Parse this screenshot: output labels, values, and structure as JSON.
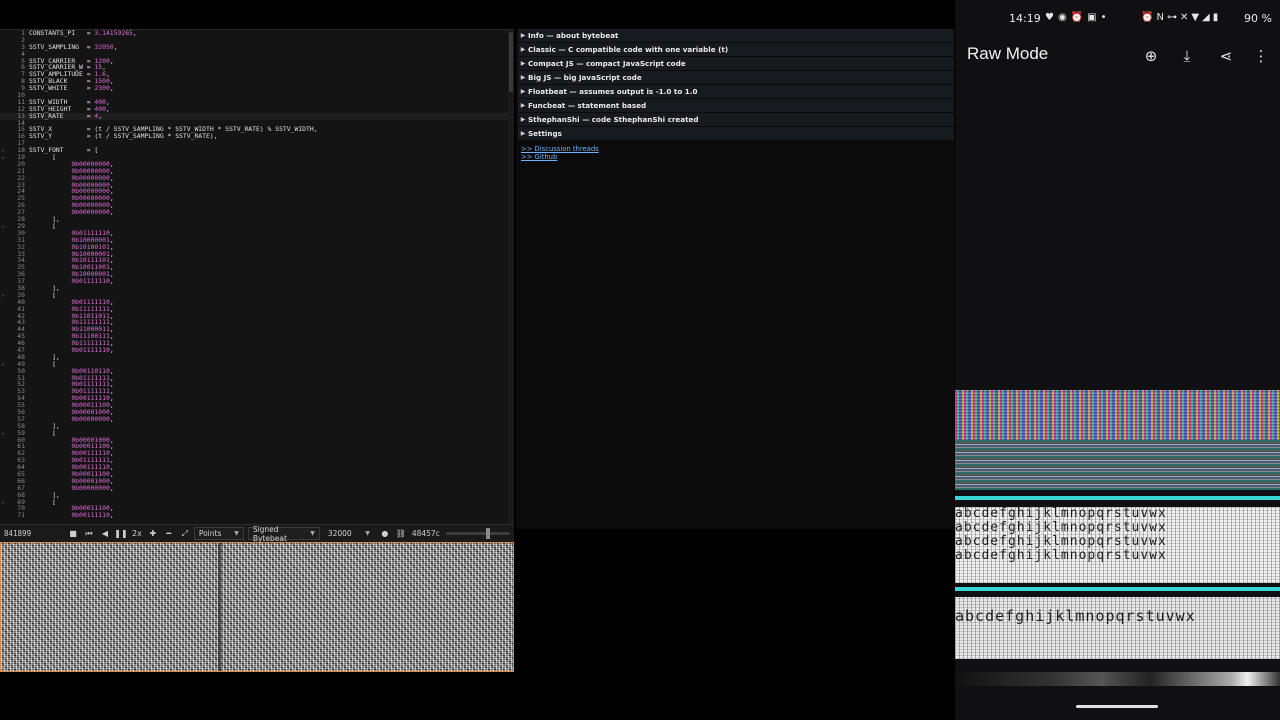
{
  "editor": {
    "lines": [
      {
        "n": "1",
        "code": [
          [
            "i",
            "CONSTANTS_PI   = "
          ],
          [
            "n",
            "3.14159265"
          ],
          [
            "i",
            ","
          ]
        ]
      },
      {
        "n": "2",
        "code": []
      },
      {
        "n": "3",
        "code": [
          [
            "i",
            "SSTV_SAMPLING  = "
          ],
          [
            "n",
            "32050"
          ],
          [
            "i",
            ","
          ]
        ]
      },
      {
        "n": "4",
        "code": []
      },
      {
        "n": "5",
        "code": [
          [
            "i",
            "SSTV_CARRIER   = "
          ],
          [
            "n",
            "1200"
          ],
          [
            "i",
            ","
          ]
        ]
      },
      {
        "n": "6",
        "code": [
          [
            "i",
            "SSTV_CARRIER_W = "
          ],
          [
            "n",
            "15"
          ],
          [
            "i",
            ","
          ]
        ]
      },
      {
        "n": "7",
        "code": [
          [
            "i",
            "SSTV_AMPLITUDE = "
          ],
          [
            "n",
            "1.6"
          ],
          [
            "i",
            ","
          ]
        ]
      },
      {
        "n": "8",
        "code": [
          [
            "i",
            "SSTV_BLACK     = "
          ],
          [
            "n",
            "1500"
          ],
          [
            "i",
            ","
          ]
        ]
      },
      {
        "n": "9",
        "code": [
          [
            "i",
            "SSTV_WHITE     = "
          ],
          [
            "n",
            "2300"
          ],
          [
            "i",
            ","
          ]
        ]
      },
      {
        "n": "10",
        "code": []
      },
      {
        "n": "11",
        "code": [
          [
            "i",
            "SSTV_WIDTH     = "
          ],
          [
            "n",
            "400"
          ],
          [
            "i",
            ","
          ]
        ]
      },
      {
        "n": "12",
        "code": [
          [
            "i",
            "SSTV_HEIGHT    = "
          ],
          [
            "n",
            "400"
          ],
          [
            "i",
            ","
          ]
        ]
      },
      {
        "n": "13",
        "code": [
          [
            "i",
            "SSTV_RATE      = "
          ],
          [
            "n",
            "4"
          ],
          [
            "i",
            ","
          ]
        ],
        "current": true
      },
      {
        "n": "14",
        "code": []
      },
      {
        "n": "15",
        "code": [
          [
            "i",
            "SSTV_X         = (t / SSTV_SAMPLING * SSTV_WIDTH * SSTV_RATE) % SSTV_WIDTH,"
          ]
        ]
      },
      {
        "n": "16",
        "code": [
          [
            "i",
            "SSTV_Y         = (t / SSTV_SAMPLING * SSTV_RATE),"
          ]
        ]
      },
      {
        "n": "17",
        "code": []
      },
      {
        "n": "18",
        "code": [
          [
            "i",
            "SSTV_FONT      = ["
          ]
        ],
        "fold": true
      },
      {
        "n": "19",
        "code": [
          [
            "i",
            "      ["
          ]
        ],
        "fold": true
      },
      {
        "n": "20",
        "code": [
          [
            "i",
            "           "
          ],
          [
            "n",
            "0b00000000"
          ],
          [
            "i",
            ","
          ]
        ]
      },
      {
        "n": "21",
        "code": [
          [
            "i",
            "           "
          ],
          [
            "n",
            "0b00000000"
          ],
          [
            "i",
            ","
          ]
        ]
      },
      {
        "n": "22",
        "code": [
          [
            "i",
            "           "
          ],
          [
            "n",
            "0b00000000"
          ],
          [
            "i",
            ","
          ]
        ]
      },
      {
        "n": "23",
        "code": [
          [
            "i",
            "           "
          ],
          [
            "n",
            "0b00000000"
          ],
          [
            "i",
            ","
          ]
        ]
      },
      {
        "n": "24",
        "code": [
          [
            "i",
            "           "
          ],
          [
            "n",
            "0b00000000"
          ],
          [
            "i",
            ","
          ]
        ]
      },
      {
        "n": "25",
        "code": [
          [
            "i",
            "           "
          ],
          [
            "n",
            "0b00000000"
          ],
          [
            "i",
            ","
          ]
        ]
      },
      {
        "n": "26",
        "code": [
          [
            "i",
            "           "
          ],
          [
            "n",
            "0b00000000"
          ],
          [
            "i",
            ","
          ]
        ]
      },
      {
        "n": "27",
        "code": [
          [
            "i",
            "           "
          ],
          [
            "n",
            "0b00000000"
          ],
          [
            "i",
            ","
          ]
        ]
      },
      {
        "n": "28",
        "code": [
          [
            "i",
            "      ],"
          ]
        ]
      },
      {
        "n": "29",
        "code": [
          [
            "i",
            "      ["
          ]
        ],
        "fold": true
      },
      {
        "n": "30",
        "code": [
          [
            "i",
            "           "
          ],
          [
            "n",
            "0b01111110"
          ],
          [
            "i",
            ","
          ]
        ]
      },
      {
        "n": "31",
        "code": [
          [
            "i",
            "           "
          ],
          [
            "n",
            "0b10000001"
          ],
          [
            "i",
            ","
          ]
        ]
      },
      {
        "n": "32",
        "code": [
          [
            "i",
            "           "
          ],
          [
            "n",
            "0b10100101"
          ],
          [
            "i",
            ","
          ]
        ]
      },
      {
        "n": "33",
        "code": [
          [
            "i",
            "           "
          ],
          [
            "n",
            "0b10000001"
          ],
          [
            "i",
            ","
          ]
        ]
      },
      {
        "n": "34",
        "code": [
          [
            "i",
            "           "
          ],
          [
            "n",
            "0b10111101"
          ],
          [
            "i",
            ","
          ]
        ]
      },
      {
        "n": "35",
        "code": [
          [
            "i",
            "           "
          ],
          [
            "n",
            "0b10011001"
          ],
          [
            "i",
            ","
          ]
        ]
      },
      {
        "n": "36",
        "code": [
          [
            "i",
            "           "
          ],
          [
            "n",
            "0b10000001"
          ],
          [
            "i",
            ","
          ]
        ]
      },
      {
        "n": "37",
        "code": [
          [
            "i",
            "           "
          ],
          [
            "n",
            "0b01111110"
          ],
          [
            "i",
            ","
          ]
        ]
      },
      {
        "n": "38",
        "code": [
          [
            "i",
            "      ],"
          ]
        ]
      },
      {
        "n": "39",
        "code": [
          [
            "i",
            "      ["
          ]
        ],
        "fold": true
      },
      {
        "n": "40",
        "code": [
          [
            "i",
            "           "
          ],
          [
            "n",
            "0b01111110"
          ],
          [
            "i",
            ","
          ]
        ]
      },
      {
        "n": "41",
        "code": [
          [
            "i",
            "           "
          ],
          [
            "n",
            "0b11111111"
          ],
          [
            "i",
            ","
          ]
        ]
      },
      {
        "n": "42",
        "code": [
          [
            "i",
            "           "
          ],
          [
            "n",
            "0b11011011"
          ],
          [
            "i",
            ","
          ]
        ]
      },
      {
        "n": "43",
        "code": [
          [
            "i",
            "           "
          ],
          [
            "n",
            "0b11111111"
          ],
          [
            "i",
            ","
          ]
        ]
      },
      {
        "n": "44",
        "code": [
          [
            "i",
            "           "
          ],
          [
            "n",
            "0b11000011"
          ],
          [
            "i",
            ","
          ]
        ]
      },
      {
        "n": "45",
        "code": [
          [
            "i",
            "           "
          ],
          [
            "n",
            "0b11100111"
          ],
          [
            "i",
            ","
          ]
        ]
      },
      {
        "n": "46",
        "code": [
          [
            "i",
            "           "
          ],
          [
            "n",
            "0b11111111"
          ],
          [
            "i",
            ","
          ]
        ]
      },
      {
        "n": "47",
        "code": [
          [
            "i",
            "           "
          ],
          [
            "n",
            "0b01111110"
          ],
          [
            "i",
            ","
          ]
        ]
      },
      {
        "n": "48",
        "code": [
          [
            "i",
            "      ],"
          ]
        ]
      },
      {
        "n": "49",
        "code": [
          [
            "i",
            "      ["
          ]
        ],
        "fold": true
      },
      {
        "n": "50",
        "code": [
          [
            "i",
            "           "
          ],
          [
            "n",
            "0b00110110"
          ],
          [
            "i",
            ","
          ]
        ]
      },
      {
        "n": "51",
        "code": [
          [
            "i",
            "           "
          ],
          [
            "n",
            "0b01111111"
          ],
          [
            "i",
            ","
          ]
        ]
      },
      {
        "n": "52",
        "code": [
          [
            "i",
            "           "
          ],
          [
            "n",
            "0b01111111"
          ],
          [
            "i",
            ","
          ]
        ]
      },
      {
        "n": "53",
        "code": [
          [
            "i",
            "           "
          ],
          [
            "n",
            "0b01111111"
          ],
          [
            "i",
            ","
          ]
        ]
      },
      {
        "n": "54",
        "code": [
          [
            "i",
            "           "
          ],
          [
            "n",
            "0b00111110"
          ],
          [
            "i",
            ","
          ]
        ]
      },
      {
        "n": "55",
        "code": [
          [
            "i",
            "           "
          ],
          [
            "n",
            "0b00011100"
          ],
          [
            "i",
            ","
          ]
        ]
      },
      {
        "n": "56",
        "code": [
          [
            "i",
            "           "
          ],
          [
            "n",
            "0b00001000"
          ],
          [
            "i",
            ","
          ]
        ]
      },
      {
        "n": "57",
        "code": [
          [
            "i",
            "           "
          ],
          [
            "n",
            "0b00000000"
          ],
          [
            "i",
            ","
          ]
        ]
      },
      {
        "n": "58",
        "code": [
          [
            "i",
            "      ],"
          ]
        ]
      },
      {
        "n": "59",
        "code": [
          [
            "i",
            "      ["
          ]
        ],
        "fold": true
      },
      {
        "n": "60",
        "code": [
          [
            "i",
            "           "
          ],
          [
            "n",
            "0b00001000"
          ],
          [
            "i",
            ","
          ]
        ]
      },
      {
        "n": "61",
        "code": [
          [
            "i",
            "           "
          ],
          [
            "n",
            "0b00011100"
          ],
          [
            "i",
            ","
          ]
        ]
      },
      {
        "n": "62",
        "code": [
          [
            "i",
            "           "
          ],
          [
            "n",
            "0b00111110"
          ],
          [
            "i",
            ","
          ]
        ]
      },
      {
        "n": "63",
        "code": [
          [
            "i",
            "           "
          ],
          [
            "n",
            "0b01111111"
          ],
          [
            "i",
            ","
          ]
        ]
      },
      {
        "n": "64",
        "code": [
          [
            "i",
            "           "
          ],
          [
            "n",
            "0b00111110"
          ],
          [
            "i",
            ","
          ]
        ]
      },
      {
        "n": "65",
        "code": [
          [
            "i",
            "           "
          ],
          [
            "n",
            "0b00011100"
          ],
          [
            "i",
            ","
          ]
        ]
      },
      {
        "n": "66",
        "code": [
          [
            "i",
            "           "
          ],
          [
            "n",
            "0b00001000"
          ],
          [
            "i",
            ","
          ]
        ]
      },
      {
        "n": "67",
        "code": [
          [
            "i",
            "           "
          ],
          [
            "n",
            "0b00000000"
          ],
          [
            "i",
            ","
          ]
        ]
      },
      {
        "n": "68",
        "code": [
          [
            "i",
            "      ],"
          ]
        ]
      },
      {
        "n": "69",
        "code": [
          [
            "i",
            "      ["
          ]
        ],
        "fold": true
      },
      {
        "n": "70",
        "code": [
          [
            "i",
            "           "
          ],
          [
            "n",
            "0b00011100"
          ],
          [
            "i",
            ","
          ]
        ]
      },
      {
        "n": "71",
        "code": [
          [
            "i",
            "           "
          ],
          [
            "n",
            "0b00111110"
          ],
          [
            "i",
            ","
          ]
        ]
      }
    ]
  },
  "controls": {
    "time": "841899",
    "rate_label": "2x",
    "mode": "Points",
    "type": "Signed Bytebeat",
    "sample_rate": "32000",
    "code_length": "48457c"
  },
  "library": {
    "sections": [
      "Info — about bytebeat",
      "Classic — C compatible code with one variable (t)",
      "Compact JS — compact JavaScript code",
      "Big JS — big JavaScript code",
      "Floatbeat — assumes output is -1.0 to 1.0",
      "Funcbeat — statement based",
      "SthephanShi — code SthephanShi created",
      "Settings"
    ],
    "links": [
      ">> Discussion threads",
      ">> Github"
    ]
  },
  "phone": {
    "status": {
      "time": "14:19",
      "battery": "90 %"
    },
    "app_title": "Raw Mode",
    "decoded_text_rows": [
      "abcdefghijklmnopqrstuvwx",
      "abcdefghijklmnopqrstuvwx",
      "abcdefghijklmnopqrstuvwx",
      "abcdefghijklmnopqrstuvwx",
      "abcdefghijklmnopqrstuvwx"
    ]
  }
}
